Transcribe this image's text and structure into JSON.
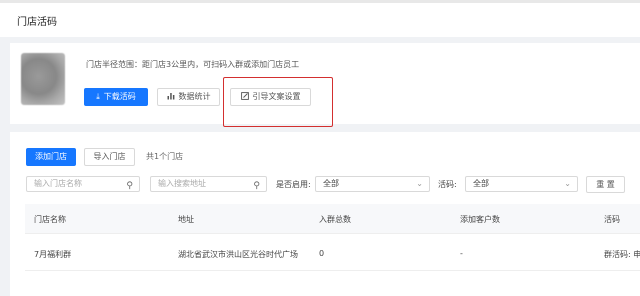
{
  "header": {
    "title": "门店活码"
  },
  "store_card": {
    "description": "门店半径范围：距门店3公里内，可扫码入群或添加门店员工",
    "download_label": "下载活码",
    "stats_label": "数据统计",
    "guide_label": "引导文案设置"
  },
  "toolbar": {
    "add_store_label": "添加门店",
    "import_store_label": "导入门店",
    "count_text": "共1个门店"
  },
  "filters": {
    "store_name_placeholder": "输入门店名称",
    "address_placeholder": "输入搜索地址",
    "enabled_label": "是否启用:",
    "enabled_value": "全部",
    "code_label": "活码:",
    "code_value": "全部",
    "reset_label": "重 置"
  },
  "table": {
    "headers": [
      "门店名称",
      "地址",
      "入群总数",
      "添加客户数",
      "活码"
    ],
    "rows": [
      {
        "name": "7月福利群",
        "address": "湖北省武汉市洪山区光谷时代广场",
        "group_total": "0",
        "customers": "-",
        "code": "群活码: 申"
      }
    ]
  },
  "colors": {
    "primary": "#1677ff",
    "highlight": "#d32f2f"
  }
}
